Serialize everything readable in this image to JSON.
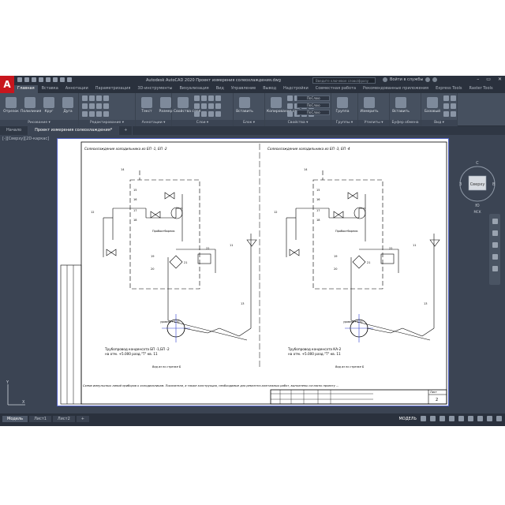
{
  "app": {
    "logo_letter": "A",
    "window_title": "Autodesk AutoCAD 2020   Проект измерения солеохлаждения.dwg",
    "search_placeholder": "Введите ключевое слово/фразу",
    "user_name": "Войти в службы"
  },
  "ribbon_tabs": [
    "Главная",
    "Вставка",
    "Аннотации",
    "Параметризация",
    "3D-инструменты",
    "Визуализация",
    "Вид",
    "Управление",
    "Вывод",
    "Надстройки",
    "Совместная работа",
    "Рекомендованные приложения",
    "Express Tools",
    "Raster Tools"
  ],
  "ribbon_panels": [
    {
      "label": "Рисование ▾",
      "buttons": [
        "Отрезок",
        "Полилиния",
        "Круг",
        "Дуга"
      ]
    },
    {
      "label": "Редактирование ▾",
      "buttons": []
    },
    {
      "label": "Аннотации ▾",
      "buttons": [
        "Текст",
        "Размер"
      ]
    },
    {
      "label": "Слои ▾",
      "buttons": [
        "Свойства слоя"
      ]
    },
    {
      "label": "Блок ▾",
      "buttons": [
        "Вставить"
      ]
    },
    {
      "label": "Свойства ▾",
      "buttons": [
        "Копирование свойств"
      ]
    },
    {
      "label": "Группы ▾",
      "buttons": [
        "Группа"
      ]
    },
    {
      "label": "Утилиты ▾",
      "buttons": [
        "Измерить"
      ]
    },
    {
      "label": "Буфер обмена",
      "buttons": [
        "Вставить"
      ]
    },
    {
      "label": "Вид ▾",
      "buttons": [
        "Базовый"
      ]
    }
  ],
  "property_combos": [
    "ПоСлою",
    "ПоСлою",
    "ПоСлою"
  ],
  "doc_tabs": [
    "Начало",
    "Проект измерения солеохлаждения*"
  ],
  "viewport_label": "[-][Сверху][2D-каркас]",
  "viewcube": {
    "face": "Сверху",
    "north": "С",
    "south": "Ю",
    "west": "З",
    "east": "В",
    "wcs": "МСК"
  },
  "ucs": {
    "x": "X",
    "y": "Y"
  },
  "drawing": {
    "left": {
      "title": "Солеохлаждение холодильника из БП -1, БП -2",
      "pipe_caption_line1": "Трубопровод конденсата БП -1,БП -2",
      "pipe_caption_line2": "на отм. +5.000 разд.\"Т\" кв. 11"
    },
    "right": {
      "title": "Солеохлаждение холодильника из БП -3, БП -4",
      "pipe_caption_line1": "Трубопровод конденсата КА-2",
      "pipe_caption_line2": "на отм. +5.000 разд.\"Т\" кв. 11"
    },
    "sample_text": "Пробоотборник",
    "level_text": "уровень +1.10",
    "view_label": "Вид из по стрелке Б",
    "notes": "Схема импульсных линий приборов к холодильникам. Показатели, а также конструкция, необходимые для ремонтно-монтажных работ, выполнены согласно проекту ...",
    "stamp_sheet": "Лист",
    "stamp_page": "2",
    "tags": [
      "14",
      "15",
      "16",
      "17",
      "18",
      "19",
      "20",
      "21",
      "22",
      "11",
      "12",
      "13"
    ]
  },
  "layout_tabs": [
    "Модель",
    "Лист1",
    "Лист2",
    "+"
  ],
  "status": {
    "mode": "МОДЕЛЬ"
  }
}
